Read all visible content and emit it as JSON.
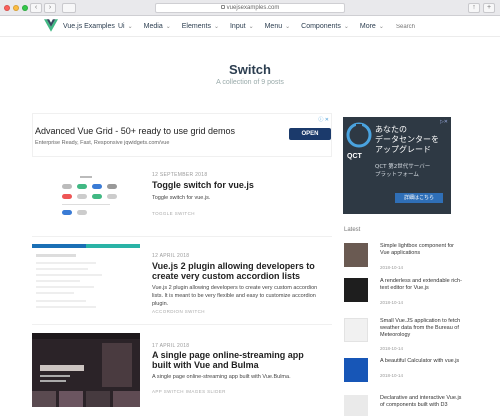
{
  "browser": {
    "url": "vuejsexamples.com"
  },
  "header": {
    "brand": "Vue.js Examples",
    "menu": [
      {
        "label": "Ui"
      },
      {
        "label": "Media"
      },
      {
        "label": "Elements"
      },
      {
        "label": "Input"
      },
      {
        "label": "Menu"
      },
      {
        "label": "Components"
      },
      {
        "label": "More"
      }
    ],
    "search_placeholder": "Search",
    "brand_color": "#41b883"
  },
  "page": {
    "title": "Switch",
    "subtitle": "A collection of 9 posts"
  },
  "ad": {
    "title": "Advanced Vue Grid - 50+ ready to use grid demos",
    "description": "Enterprise Ready, Fast, Responsive jqwidgets.com/vue",
    "button": "OPEN"
  },
  "posts": [
    {
      "date": "12 SEPTEMBER 2018",
      "title": "Toggle switch for vue.js",
      "excerpt": "Toggle switch for vue.js.",
      "tags": "TOGGLE  SWITCH"
    },
    {
      "date": "12 APRIL 2018",
      "title": "Vue.js 2 plugin allowing developers to create very custom accordion lists",
      "excerpt": "Vue.js 2 plugin allowing developers to create very custom accordion lists. It is meant to be very flexible and easy to customize accordion plugin.",
      "tags": "ACCORDION  SWITCH"
    },
    {
      "date": "17 APRIL 2018",
      "title": "A single page online-streaming app built with Vue and Bulma",
      "excerpt": "A single page online-streaming app built with Vue.Bulma.",
      "tags": "APP  SWITCH  IMAGES  SLIDER"
    }
  ],
  "sidebar_ad": {
    "headline": "あなたの\nデータセンターを\nアップグレード",
    "brand": "QCT",
    "sub": "QCT 第2世代サーバー\nプラットフォーム",
    "cta": "詳細はこちら"
  },
  "latest": {
    "heading": "Latest",
    "items": [
      {
        "title": "Simple lightbox component for Vue applications",
        "date": "2018-10-14"
      },
      {
        "title": "A renderless and extendable rich-text editor for Vue.js",
        "date": "2018-10-14"
      },
      {
        "title": "Small Vue.JS application to fetch weather data from the Bureau of Meteorology",
        "date": "2018-10-14"
      },
      {
        "title": "A beautiful Calculator with vue.js",
        "date": "2018-10-14"
      },
      {
        "title": "Declarative and interactive Vue.js of components built with D3",
        "date": ""
      }
    ]
  }
}
